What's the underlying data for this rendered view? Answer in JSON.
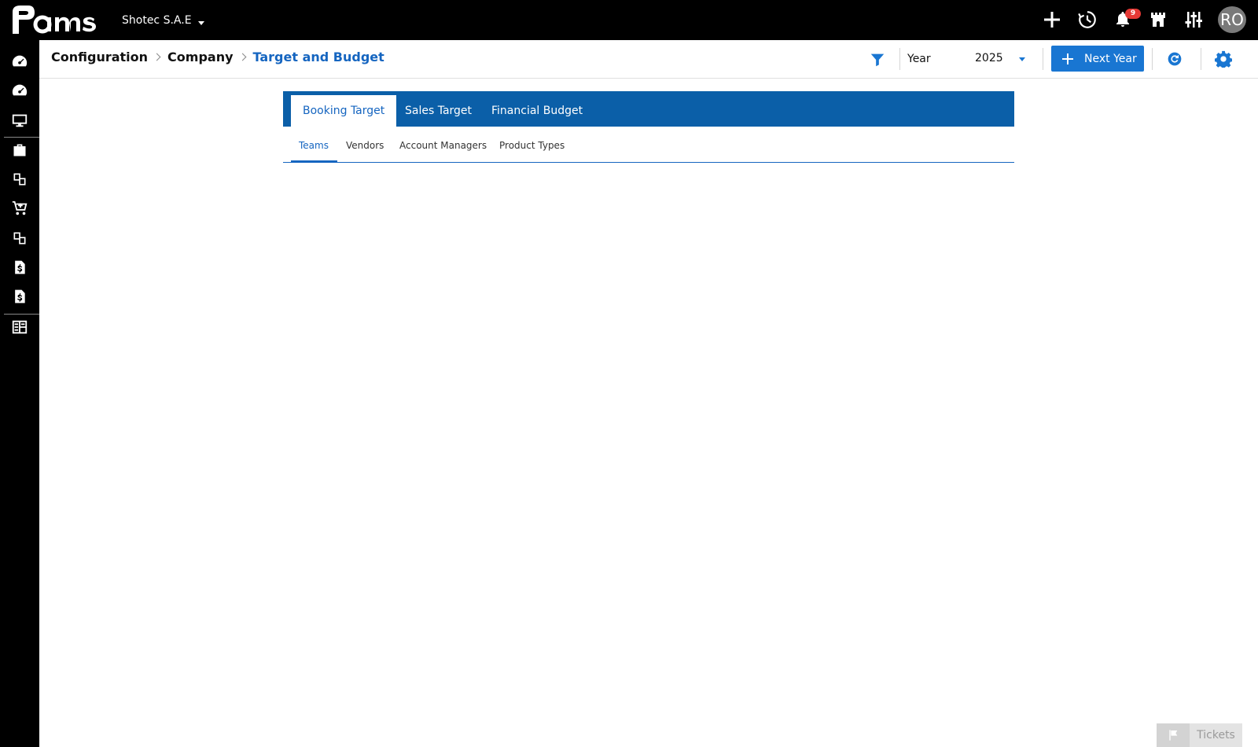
{
  "app": {
    "logo_text": "Pams",
    "company_name": "Shotec S.A.E",
    "notification_count": "9",
    "user_initials": "RO"
  },
  "breadcrumb": {
    "items": [
      "Configuration",
      "Company"
    ],
    "current": "Target and Budget"
  },
  "toolbar": {
    "year_label": "Year",
    "year_value": "2025",
    "next_year_label": "Next Year"
  },
  "tabs": [
    {
      "label": "Booking Target",
      "active": true
    },
    {
      "label": "Sales Target",
      "active": false
    },
    {
      "label": "Financial Budget",
      "active": false
    }
  ],
  "subtabs": [
    {
      "label": "Teams",
      "active": true
    },
    {
      "label": "Vendors",
      "active": false
    },
    {
      "label": "Account Managers",
      "active": false
    },
    {
      "label": "Product Types",
      "active": false
    }
  ],
  "tickets": {
    "label": "Tickets"
  },
  "colors": {
    "accent": "#1976d2",
    "tabbar": "#0b5fa8",
    "topbar": "#000000",
    "badge": "#e53935"
  }
}
